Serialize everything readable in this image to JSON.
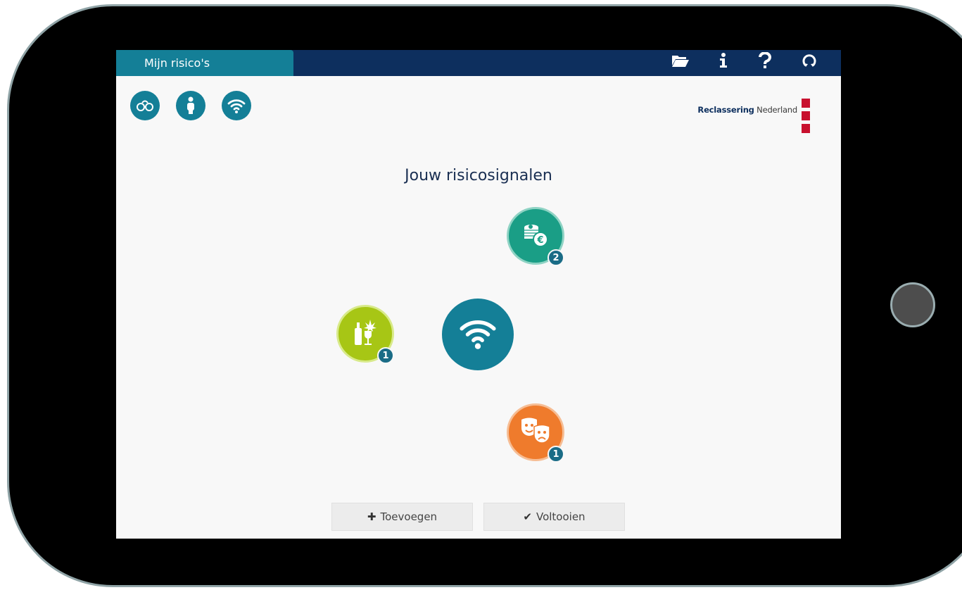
{
  "header": {
    "tab_label": "Mijn risico's"
  },
  "toolbar_icons": [
    "folder-open-icon",
    "info-icon",
    "help-icon",
    "refresh-icon"
  ],
  "logo": {
    "bold": "Reclassering",
    "regular": " Nederland"
  },
  "main": {
    "title": "Jouw risicosignalen",
    "signals": [
      {
        "icon": "money-coins-icon",
        "color": "#1a9e86",
        "count": "2"
      },
      {
        "icon": "alcohol-drugs-icon",
        "color": "#a7c615",
        "count": "1"
      },
      {
        "icon": "theater-masks-icon",
        "color": "#ef7b2c",
        "count": "1"
      }
    ],
    "center_icon": "wifi-signal-icon"
  },
  "footer": {
    "add_label": "Toevoegen",
    "complete_label": "Voltooien"
  },
  "colors": {
    "primary": "#147f97",
    "navy": "#0d2f5e",
    "brand_red": "#c8102e"
  }
}
